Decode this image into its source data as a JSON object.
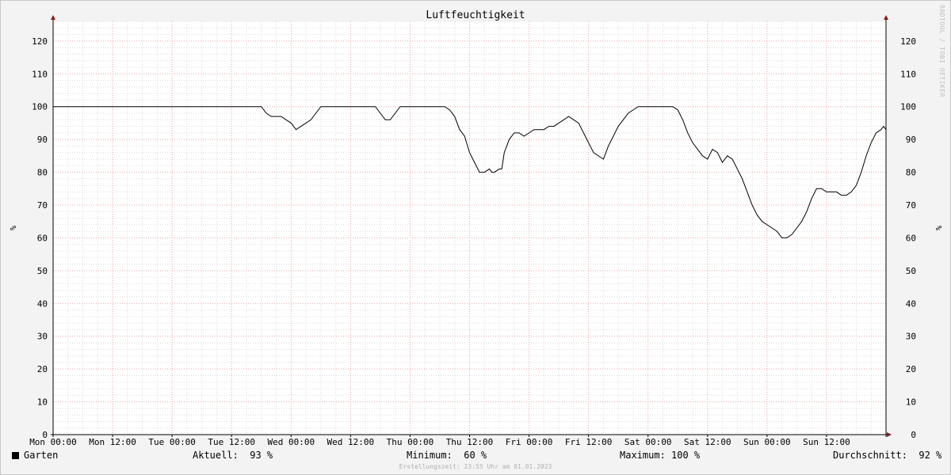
{
  "chart_data": {
    "type": "line",
    "title": "Luftfeuchtigkeit",
    "ylabel": "%",
    "ylim": [
      0,
      126
    ],
    "yticks": [
      0,
      10,
      20,
      30,
      40,
      50,
      60,
      70,
      80,
      90,
      100,
      110,
      120
    ],
    "xlim": [
      0,
      168
    ],
    "xticks": [
      {
        "label": "Mon 00:00",
        "x": 0
      },
      {
        "label": "Mon 12:00",
        "x": 12
      },
      {
        "label": "Tue 00:00",
        "x": 24
      },
      {
        "label": "Tue 12:00",
        "x": 36
      },
      {
        "label": "Wed 00:00",
        "x": 48
      },
      {
        "label": "Wed 12:00",
        "x": 60
      },
      {
        "label": "Thu 00:00",
        "x": 72
      },
      {
        "label": "Thu 12:00",
        "x": 84
      },
      {
        "label": "Fri 00:00",
        "x": 96
      },
      {
        "label": "Fri 12:00",
        "x": 108
      },
      {
        "label": "Sat 00:00",
        "x": 120
      },
      {
        "label": "Sat 12:00",
        "x": 132
      },
      {
        "label": "Sun 00:00",
        "x": 144
      },
      {
        "label": "Sun 12:00",
        "x": 156
      }
    ],
    "grid": true,
    "series": [
      {
        "name": "Garten",
        "color": "#000000",
        "points": [
          [
            0,
            100
          ],
          [
            42,
            100
          ],
          [
            43,
            98
          ],
          [
            44,
            97
          ],
          [
            45,
            97
          ],
          [
            46,
            97
          ],
          [
            47,
            96
          ],
          [
            48,
            95
          ],
          [
            49,
            93
          ],
          [
            50,
            94
          ],
          [
            51,
            95
          ],
          [
            52,
            96
          ],
          [
            53,
            98
          ],
          [
            54,
            100
          ],
          [
            61,
            100
          ],
          [
            65,
            100
          ],
          [
            66,
            98
          ],
          [
            67,
            96
          ],
          [
            68,
            96
          ],
          [
            69,
            98
          ],
          [
            70,
            100
          ],
          [
            79,
            100
          ],
          [
            80,
            99
          ],
          [
            81,
            97
          ],
          [
            82,
            93
          ],
          [
            83,
            91
          ],
          [
            84,
            86
          ],
          [
            85,
            83
          ],
          [
            86,
            80
          ],
          [
            87,
            80
          ],
          [
            88,
            81
          ],
          [
            88.5,
            80
          ],
          [
            89,
            80
          ],
          [
            90,
            81
          ],
          [
            90.5,
            81
          ],
          [
            91,
            86
          ],
          [
            92,
            90
          ],
          [
            93,
            92
          ],
          [
            94,
            92
          ],
          [
            95,
            91
          ],
          [
            96,
            92
          ],
          [
            97,
            93
          ],
          [
            98,
            93
          ],
          [
            99,
            93
          ],
          [
            100,
            94
          ],
          [
            101,
            94
          ],
          [
            102,
            95
          ],
          [
            103,
            96
          ],
          [
            104,
            97
          ],
          [
            105,
            96
          ],
          [
            106,
            95
          ],
          [
            107,
            92
          ],
          [
            108,
            89
          ],
          [
            109,
            86
          ],
          [
            110,
            85
          ],
          [
            111,
            84
          ],
          [
            112,
            88
          ],
          [
            113,
            91
          ],
          [
            114,
            94
          ],
          [
            115,
            96
          ],
          [
            116,
            98
          ],
          [
            117,
            99
          ],
          [
            118,
            100
          ],
          [
            125,
            100
          ],
          [
            126,
            99
          ],
          [
            127,
            96
          ],
          [
            128,
            92
          ],
          [
            129,
            89
          ],
          [
            130,
            87
          ],
          [
            131,
            85
          ],
          [
            132,
            84
          ],
          [
            133,
            87
          ],
          [
            134,
            86
          ],
          [
            135,
            83
          ],
          [
            136,
            85
          ],
          [
            137,
            84
          ],
          [
            138,
            81
          ],
          [
            139,
            78
          ],
          [
            140,
            74
          ],
          [
            141,
            70
          ],
          [
            142,
            67
          ],
          [
            143,
            65
          ],
          [
            144,
            64
          ],
          [
            145,
            63
          ],
          [
            146,
            62
          ],
          [
            147,
            60
          ],
          [
            148,
            60
          ],
          [
            149,
            61
          ],
          [
            150,
            63
          ],
          [
            151,
            65
          ],
          [
            152,
            68
          ],
          [
            153,
            72
          ],
          [
            154,
            75
          ],
          [
            155,
            75
          ],
          [
            156,
            74
          ],
          [
            157,
            74
          ],
          [
            158,
            74
          ],
          [
            159,
            73
          ],
          [
            160,
            73
          ],
          [
            161,
            74
          ],
          [
            162,
            76
          ],
          [
            163,
            80
          ],
          [
            164,
            85
          ],
          [
            165,
            89
          ],
          [
            166,
            92
          ],
          [
            167,
            93
          ],
          [
            167.5,
            94
          ],
          [
            168,
            93
          ]
        ]
      }
    ]
  },
  "legend": {
    "series_label": "Garten",
    "current": "Aktuell:  93 %",
    "minimum": "Minimum:  60 %",
    "maximum": "Maximum: 100 %",
    "average": "Durchschnitt:  92 %"
  },
  "footer": "Erstellungszeit: 23:55 Uhr am 01.01.2023",
  "watermark": "RRDTOOL / TOBI OETIKER",
  "colors": {
    "minor_grid": "#dcdcdc",
    "major_grid": "#e8a4a4",
    "axis": "#000000",
    "arrow": "#8b1a1a",
    "line": "#000000"
  }
}
